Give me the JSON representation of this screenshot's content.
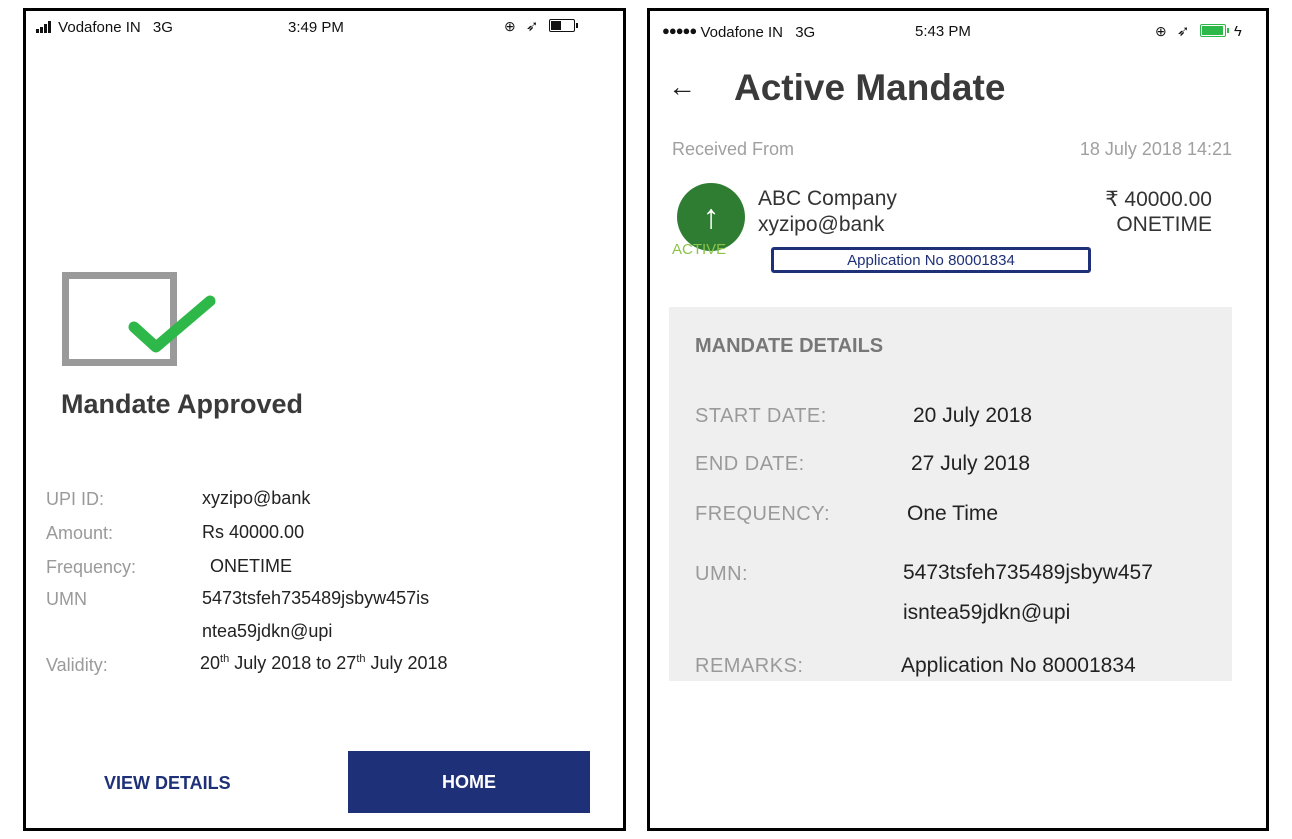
{
  "left": {
    "status": {
      "carrier": "Vodafone IN",
      "network": "3G",
      "time": "3:49 PM"
    },
    "title": "Mandate Approved",
    "fields": [
      {
        "label": "UPI ID:",
        "value": "xyzipo@bank"
      },
      {
        "label": "Amount:",
        "value": "Rs 40000.00"
      },
      {
        "label": "Frequency:",
        "value": "ONETIME"
      },
      {
        "label": "UMN",
        "value_line1": "5473tsfeh735489jsbyw457is",
        "value_line2": "ntea59jdkn@upi"
      },
      {
        "label": "Validity:",
        "day1": "20",
        "ord1": "th",
        "rest1": " July 2018 to ",
        "day2": "27",
        "ord2": "th",
        "rest2": " July 2018"
      }
    ],
    "buttons": {
      "view_details": "VIEW DETAILS",
      "home": "HOME"
    },
    "colors": {
      "primary": "#1e3178",
      "check": "#2fb84a"
    }
  },
  "right": {
    "status": {
      "carrier": "Vodafone IN",
      "network": "3G",
      "time": "5:43 PM"
    },
    "title": "Active Mandate",
    "received_label": "Received From",
    "received_datetime": "18 July 2018 14:21",
    "payee": {
      "name": "ABC Company",
      "upi": "xyzipo@bank",
      "amount": "₹ 40000.00",
      "frequency": "ONETIME",
      "status": "ACTIVE",
      "application": "Application No 80001834"
    },
    "details": {
      "title": "MANDATE DETAILS",
      "start_label": "START DATE:",
      "start_value": "20 July 2018",
      "end_label": "END DATE:",
      "end_value": "27 July 2018",
      "frequency_label": "FREQUENCY:",
      "frequency_value": "One Time",
      "umn_label": "UMN:",
      "umn_line1": "5473tsfeh735489jsbyw457",
      "umn_line2": "isntea59jdkn@upi",
      "remarks_label": "REMARKS:",
      "remarks_value": "Application No 80001834"
    },
    "colors": {
      "active_icon": "#2e7d32",
      "active_text": "#8bc34a",
      "box_border": "#1e3178"
    }
  }
}
